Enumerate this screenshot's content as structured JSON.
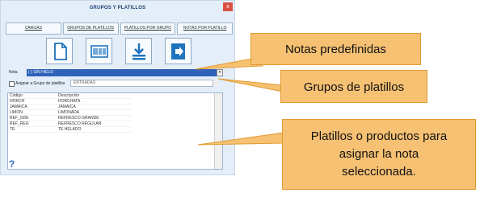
{
  "window": {
    "title": "GRUPOS Y PLATILLOS",
    "close_label": "x"
  },
  "tabs": [
    {
      "label": "CARGAS"
    },
    {
      "label": "GRUPOS DE PLATILLOS"
    },
    {
      "label": "PLATILLOS POR GRUPO"
    },
    {
      "label": "NOTAS POR PLATILLO"
    }
  ],
  "toolbar": [
    "new-document-icon",
    "barcode-icon",
    "download-icon",
    "exit-icon"
  ],
  "form": {
    "note_label": "Nota",
    "note_value": "(-) SIN HIELO",
    "assign_label": "Asignar a Grupo de platillos",
    "group_value": "ENTRADAS"
  },
  "table": {
    "columns": [
      "Código",
      "Descripción"
    ],
    "rows": [
      [
        "HORCH",
        "HORCHATA"
      ],
      [
        "JAMAICA",
        "JAMAICA"
      ],
      [
        "LIMON",
        "LIMONADA"
      ],
      [
        "REF_GDE",
        "REFRESCO GRANDE"
      ],
      [
        "REF_REG",
        "REFRESCO REGULAR"
      ],
      [
        "TE",
        "TE HELADO"
      ]
    ]
  },
  "help_label": "?",
  "callouts": {
    "notas": "Notas predefinidas",
    "grupos": "Grupos de platillos",
    "platillos_line1": "Platillos o productos para",
    "platillos_line2": "asignar la nota",
    "platillos_line3": "seleccionada."
  },
  "colors": {
    "accent": "#2d62b8",
    "callout_fill": "#f6c173",
    "callout_border": "#e09a2f"
  }
}
